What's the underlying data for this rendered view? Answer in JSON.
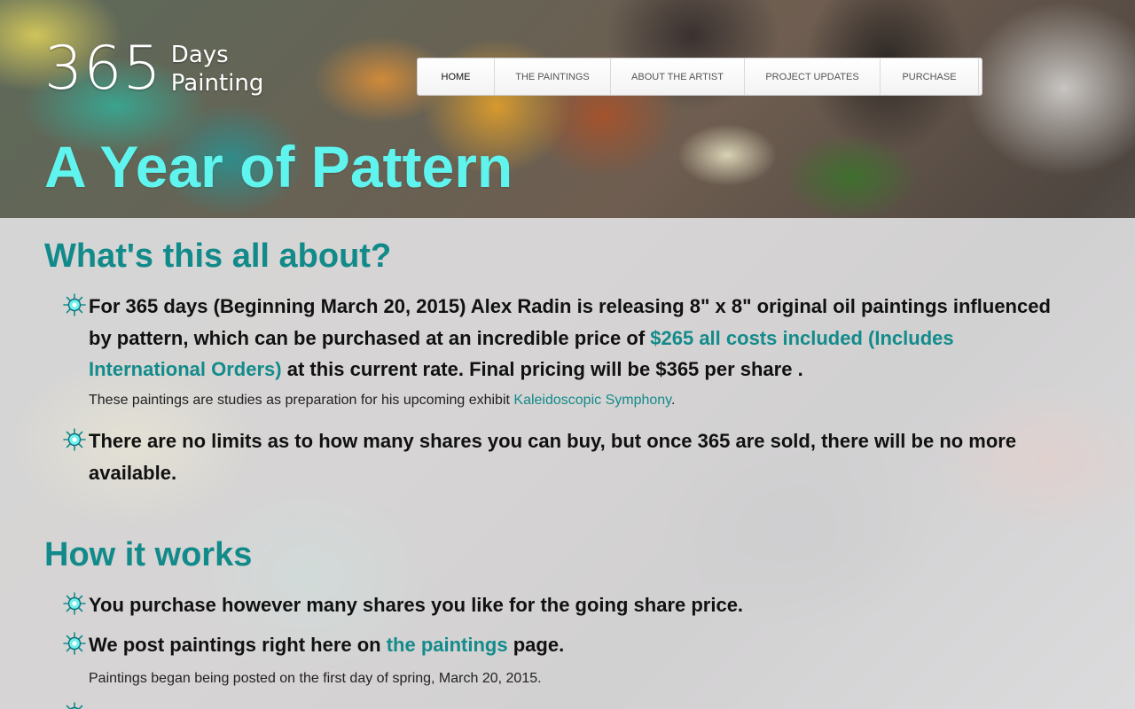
{
  "logo": {
    "number": "365",
    "line1": "Days",
    "line2": "Painting"
  },
  "nav": {
    "items": [
      {
        "label": "HOME"
      },
      {
        "label": "THE PAINTINGS"
      },
      {
        "label": "ABOUT THE ARTIST"
      },
      {
        "label": "PROJECT UPDATES"
      },
      {
        "label": "PURCHASE"
      }
    ],
    "active": "HOME"
  },
  "hero": {
    "title": "A Year of Pattern"
  },
  "about": {
    "title": "What's this all about?",
    "item1": {
      "text_before": "For 365 days (Beginning March 20, 2015) Alex Radin is releasing 8\" x 8\" original oil paintings influenced by pattern, which can be purchased at an incredible price of ",
      "link": "$265 all costs included (Includes International Orders)",
      "text_after": " at this current rate. Final pricing will be $365 per share .",
      "note_before": "These paintings are studies as preparation for his upcoming exhibit ",
      "note_link": "Kaleidoscopic Symphony",
      "note_after": "."
    },
    "item2": {
      "text": "There are no limits as to how many shares you can buy, but once 365 are sold, there will be no more available."
    }
  },
  "how": {
    "title": "How it works",
    "item1": {
      "text": "You purchase however many shares you like for the going share price."
    },
    "item2": {
      "text_before": "We post paintings right here on ",
      "link": "the paintings",
      "text_after": " page.",
      "note": "Paintings began being posted on the first day of spring, March 20, 2015."
    }
  },
  "colors": {
    "accent": "#138b8b",
    "hero_title": "#5ff4ee",
    "body_text": "#111111"
  },
  "icons": {
    "bullet": "starburst-bullet-icon"
  }
}
